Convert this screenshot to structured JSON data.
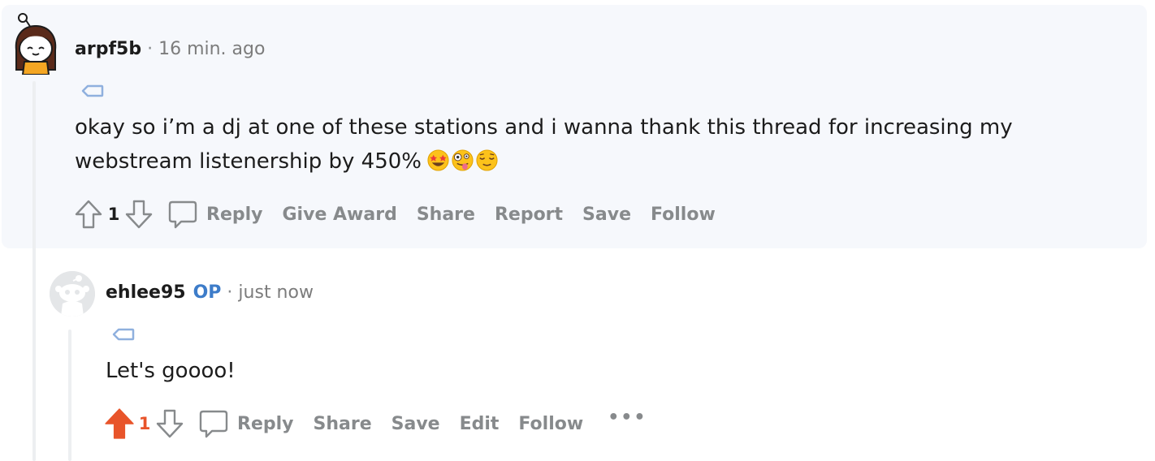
{
  "comments": [
    {
      "username": "arpf5b",
      "separator": "·",
      "time": "16 min. ago",
      "body": "okay so i’m a dj at one of these stations and i wanna thank this thread for increasing my webstream listenership by 450%",
      "emojis": [
        "star-struck-emoji",
        "zany-face-emoji",
        "relieved-face-emoji"
      ],
      "score": "1",
      "upvoted": false,
      "actions": {
        "reply": "Reply",
        "give_award": "Give Award",
        "share": "Share",
        "report": "Report",
        "save": "Save",
        "follow": "Follow"
      }
    },
    {
      "username": "ehlee95",
      "op_badge": "OP",
      "separator": "·",
      "time": "just now",
      "body": "Let's goooo!",
      "score": "1",
      "upvoted": true,
      "actions": {
        "reply": "Reply",
        "share": "Share",
        "save": "Save",
        "edit": "Edit",
        "follow": "Follow",
        "more": "•••"
      }
    }
  ],
  "colors": {
    "upvote_active": "#e8542a",
    "op_badge": "#3d7cc9",
    "action_text": "#878a8c",
    "highlight_bg": "#f6f8fc",
    "thread_line": "#edeff1"
  }
}
